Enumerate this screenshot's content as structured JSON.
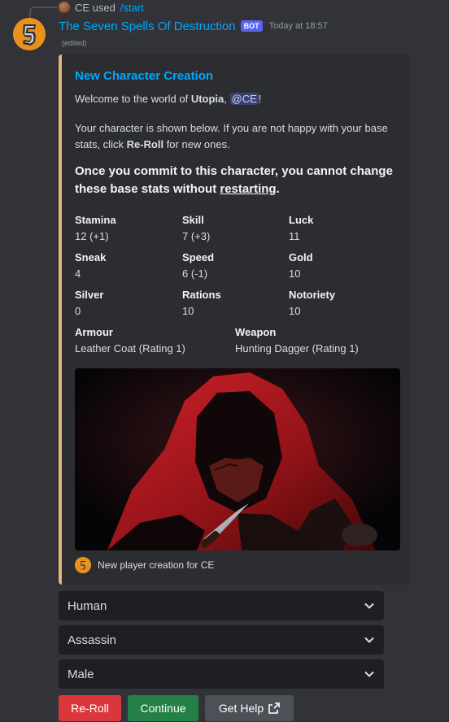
{
  "reply": {
    "user": "CE used",
    "command": "/start"
  },
  "message": {
    "bot_name": "The Seven Spells Of Destruction",
    "bot_tag": "BOT",
    "timestamp": "Today at 18:57",
    "edited": "(edited)"
  },
  "embed": {
    "accent_color": "#e2b77a",
    "title": "New Character Creation",
    "welcome_prefix": "Welcome to the world of ",
    "world": "Utopia",
    "welcome_sep": ", ",
    "mention": "@CE",
    "welcome_suffix": "!",
    "info_line1": "Your character is shown below. If you are not happy with your base",
    "info_line2_prefix": "stats, click ",
    "reroll_word": "Re-Roll",
    "info_line2_suffix": " for new ones.",
    "warning_line1": "Once you commit to this character, you cannot change",
    "warning_line2_prefix": "these base stats without ",
    "warning_link": "restarting",
    "warning_line2_suffix": ".",
    "fields": {
      "stamina": {
        "name": "Stamina",
        "value": "12 (+1)"
      },
      "skill": {
        "name": "Skill",
        "value": "7 (+3)"
      },
      "luck": {
        "name": "Luck",
        "value": "11"
      },
      "sneak": {
        "name": "Sneak",
        "value": "4"
      },
      "speed": {
        "name": "Speed",
        "value": "6 (-1)"
      },
      "gold": {
        "name": "Gold",
        "value": "10"
      },
      "silver": {
        "name": "Silver",
        "value": "0"
      },
      "rations": {
        "name": "Rations",
        "value": "10"
      },
      "notoriety": {
        "name": "Notoriety",
        "value": "10"
      },
      "armour": {
        "name": "Armour",
        "value": "Leather Coat (Rating 1)"
      },
      "weapon": {
        "name": "Weapon",
        "value": "Hunting Dagger (Rating 1)"
      }
    },
    "footer": "New player creation for CE"
  },
  "selects": [
    {
      "value": "Human"
    },
    {
      "value": "Assassin"
    },
    {
      "value": "Male"
    }
  ],
  "buttons": {
    "reroll": "Re-Roll",
    "continue": "Continue",
    "help": "Get Help"
  },
  "colors": {
    "background": "#313338",
    "embed_bg": "#2b2d31",
    "link": "#00a8fc",
    "danger": "#da373c",
    "success": "#248046",
    "secondary": "#4e5058",
    "blurple": "#5865f2"
  }
}
